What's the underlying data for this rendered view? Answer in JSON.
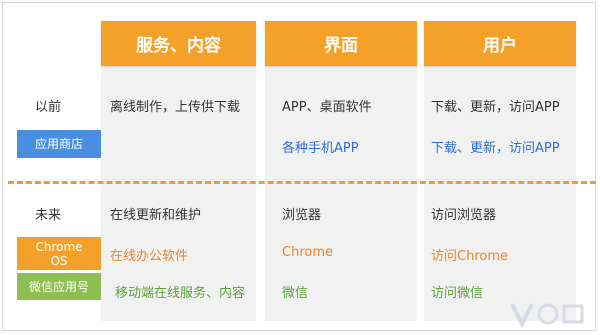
{
  "headers": [
    "服务、内容",
    "界面",
    "用户"
  ],
  "past": {
    "label": "以前",
    "tag": "应用商店",
    "row1": [
      "离线制作，上传供下载",
      "APP、桌面软件",
      "下载、更新，访问APP"
    ],
    "row2": [
      "",
      "各种手机APP",
      "下载、更新，访问APP"
    ]
  },
  "future": {
    "label": "未来",
    "tag_chrome_line1": "Chrome",
    "tag_chrome_line2": "OS",
    "tag_wechat": "微信应用号",
    "row1": [
      "在线更新和维护",
      "浏览器",
      "访问浏览器"
    ],
    "row2": [
      "在线办公软件",
      "Chrome",
      "访问Chrome"
    ],
    "row3": [
      "移动端在线服务、内容",
      "微信",
      "访问微信"
    ]
  },
  "colors": {
    "header": "#f4a12a",
    "blue": "#2e6fd0",
    "orange": "#e8862a",
    "green": "#5ea23b",
    "divider": "#f0993a"
  }
}
